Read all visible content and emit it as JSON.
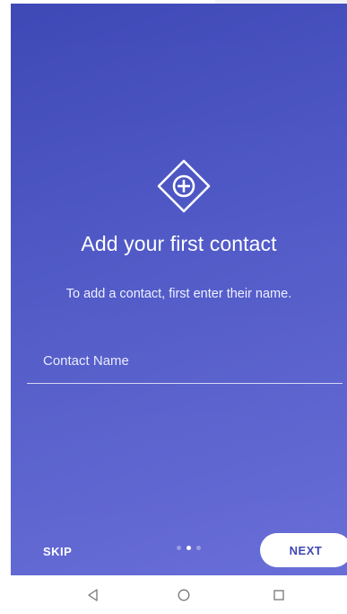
{
  "onboarding": {
    "title": "Add your first contact",
    "subtitle": "To add a contact, first enter their name.",
    "contact_field": {
      "placeholder": "Contact Name",
      "value": ""
    },
    "skip_label": "SKIP",
    "next_label": "NEXT",
    "pages": 3,
    "current_page": 2
  },
  "icons": {
    "logo": "plus-diamond-icon",
    "nav_back": "back-triangle-icon",
    "nav_home": "home-circle-icon",
    "nav_recent": "recent-apps-square-icon"
  },
  "colors": {
    "gradient_start": "#3f49b6",
    "gradient_end": "#6368d6",
    "button_bg": "#ffffff",
    "button_text": "#3f47b5"
  }
}
